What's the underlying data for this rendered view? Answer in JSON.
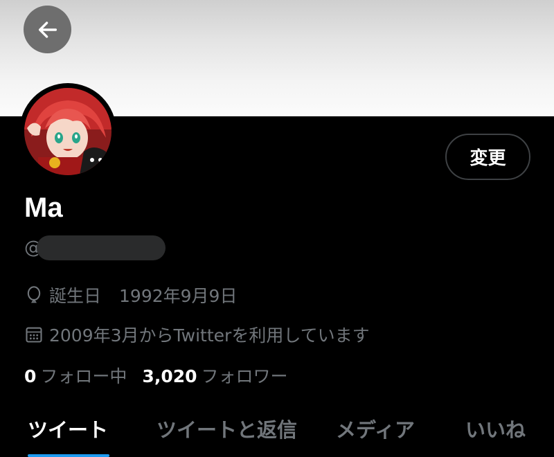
{
  "profile": {
    "display_name": "Ma",
    "handle_prefix": "@",
    "edit_label": "変更"
  },
  "birthday": {
    "label": "誕生日",
    "value": "1992年9月9日",
    "icon": "balloon-icon"
  },
  "joined": {
    "text": "2009年3月からTwitterを利用しています",
    "icon": "calendar-icon"
  },
  "stats": {
    "following_count": "0",
    "following_label": "フォロー中",
    "followers_count": "3,020",
    "followers_label": "フォロワー"
  },
  "tabs": [
    {
      "label": "ツイート",
      "active": true
    },
    {
      "label": "ツイートと返信",
      "active": false
    },
    {
      "label": "メディア",
      "active": false
    },
    {
      "label": "いいね",
      "active": false
    }
  ],
  "colors": {
    "background": "#000000",
    "muted_text": "#71767b",
    "accent": "#1d9bf0"
  }
}
